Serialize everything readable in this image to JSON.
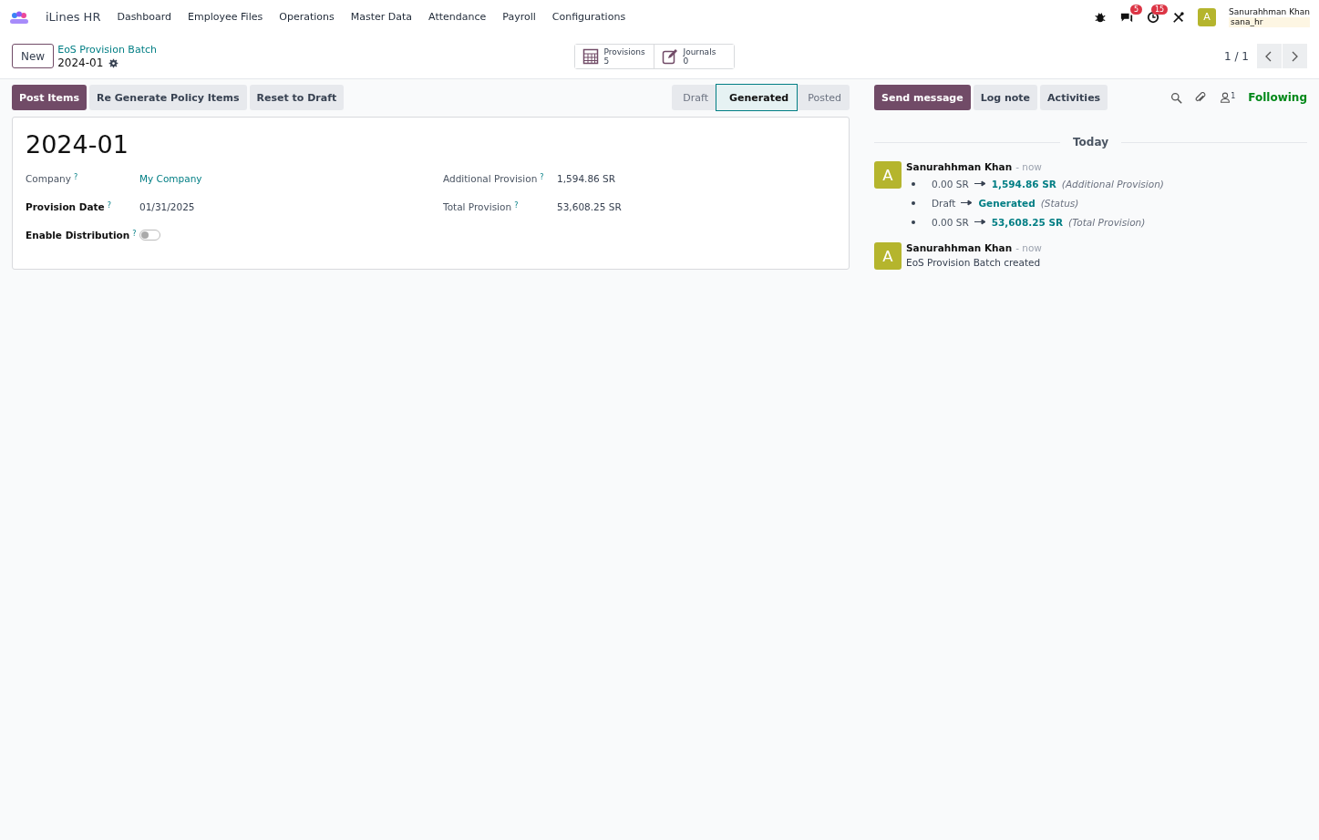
{
  "app": {
    "name": "iLines HR"
  },
  "menu": [
    {
      "label": "Dashboard"
    },
    {
      "label": "Employee Files"
    },
    {
      "label": "Operations"
    },
    {
      "label": "Master Data"
    },
    {
      "label": "Attendance"
    },
    {
      "label": "Payroll"
    },
    {
      "label": "Configurations"
    }
  ],
  "systray": {
    "messages_count": "5",
    "activities_count": "15",
    "user": {
      "initial": "A",
      "name": "Sanurahhman Khan",
      "database": "sana_hr"
    }
  },
  "control_panel": {
    "new_button": "New",
    "breadcrumb": "EoS Provision Batch",
    "record": "2024-01",
    "smart_buttons": [
      {
        "kind": "calendar",
        "label": "Provisions",
        "value": "5"
      },
      {
        "kind": "edit",
        "label": "Journals",
        "value": "0"
      }
    ],
    "pager": "1 / 1"
  },
  "actions": [
    {
      "label": "Post Items",
      "primary": true
    },
    {
      "label": "Re Generate Policy Items",
      "primary": false
    },
    {
      "label": "Reset to Draft",
      "primary": false
    }
  ],
  "statusbar": [
    {
      "label": "Draft",
      "selected": false
    },
    {
      "label": "Generated",
      "selected": true
    },
    {
      "label": "Posted",
      "selected": false
    }
  ],
  "form": {
    "title": "2024-01",
    "left_fields": [
      {
        "kind": "link",
        "label": "Company",
        "required": false,
        "help": "?",
        "value": "My Company"
      },
      {
        "kind": "text",
        "label": "Provision Date",
        "required": true,
        "help": "?",
        "value": "01/31/2025"
      },
      {
        "kind": "toggle",
        "label": "Enable Distribution",
        "required": true,
        "help": "?",
        "on": false
      }
    ],
    "right_fields": [
      {
        "kind": "text",
        "label": "Additional Provision",
        "required": false,
        "help": "?",
        "value": "1,594.86 SR"
      },
      {
        "kind": "text",
        "label": "Total Provision",
        "required": false,
        "help": "?",
        "value": "53,608.25 SR"
      }
    ]
  },
  "chatter": {
    "buttons": [
      {
        "label": "Send message",
        "primary": true
      },
      {
        "label": "Log note",
        "primary": false
      },
      {
        "label": "Activities",
        "primary": false
      }
    ],
    "followers_count": "1",
    "following": "Following",
    "date_separator": "Today",
    "messages": [
      {
        "avatar": "A",
        "author": "Sanurahhman Khan",
        "time": "- now",
        "changes": [
          {
            "old": "0.00 SR",
            "new": "1,594.86 SR",
            "field": "(Additional Provision)"
          },
          {
            "old": "Draft",
            "new": "Generated",
            "field": "(Status)"
          },
          {
            "old": "0.00 SR",
            "new": "53,608.25 SR",
            "field": "(Total Provision)"
          }
        ]
      },
      {
        "avatar": "A",
        "author": "Sanurahhman Khan",
        "time": "- now",
        "body": "EoS Provision Batch created"
      }
    ]
  }
}
